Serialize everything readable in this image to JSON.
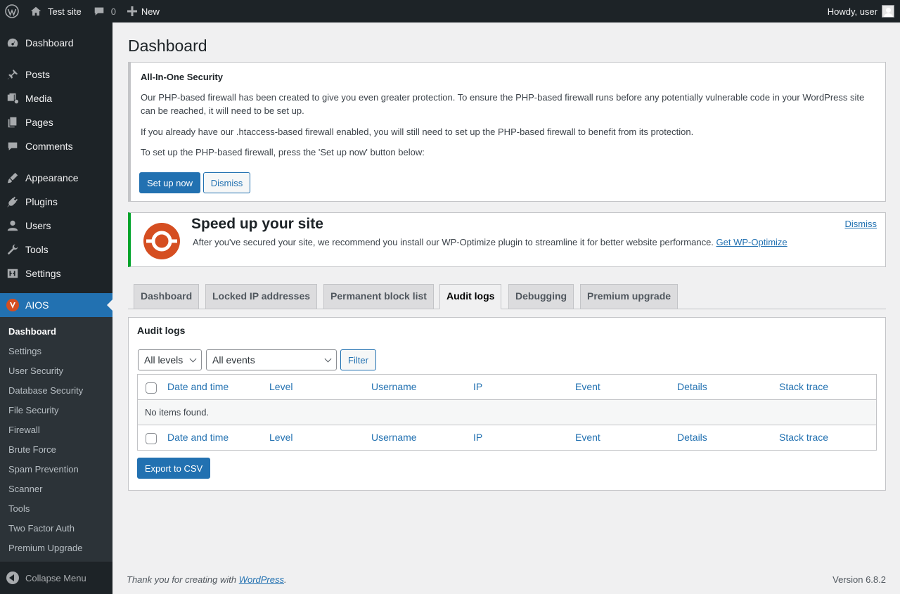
{
  "adminbar": {
    "site_name": "Test site",
    "comments_count": "0",
    "new_label": "New",
    "howdy": "Howdy, user"
  },
  "sidebar": {
    "items": [
      {
        "label": "Dashboard",
        "icon": "dashboard-icon"
      },
      {
        "label": "Posts",
        "icon": "pin-icon"
      },
      {
        "label": "Media",
        "icon": "media-icon"
      },
      {
        "label": "Pages",
        "icon": "pages-icon"
      },
      {
        "label": "Comments",
        "icon": "comment-icon"
      },
      {
        "label": "Appearance",
        "icon": "brush-icon"
      },
      {
        "label": "Plugins",
        "icon": "plug-icon"
      },
      {
        "label": "Users",
        "icon": "user-icon"
      },
      {
        "label": "Tools",
        "icon": "wrench-icon"
      },
      {
        "label": "Settings",
        "icon": "settings-icon"
      },
      {
        "label": "AIOS",
        "icon": "aios-icon"
      }
    ],
    "submenu": [
      "Dashboard",
      "Settings",
      "User Security",
      "Database Security",
      "File Security",
      "Firewall",
      "Brute Force",
      "Spam Prevention",
      "Scanner",
      "Tools",
      "Two Factor Auth",
      "Premium Upgrade"
    ],
    "collapse_label": "Collapse Menu"
  },
  "page": {
    "title": "Dashboard"
  },
  "notice_security": {
    "title": "All-In-One Security",
    "p1": "Our PHP-based firewall has been created to give you even greater protection. To ensure the PHP-based firewall runs before any potentially vulnerable code in your WordPress site can be reached, it will need to be set up.",
    "p2": "If you already have our .htaccess-based firewall enabled, you will still need to set up the PHP-based firewall to benefit from its protection.",
    "p3": "To set up the PHP-based firewall, press the 'Set up now' button below:",
    "setup_button": "Set up now",
    "dismiss_button": "Dismiss"
  },
  "notice_speed": {
    "title": "Speed up your site",
    "text": "After you've secured your site, we recommend you install our WP-Optimize plugin to streamline it for better website performance.",
    "link": "Get WP-Optimize",
    "dismiss": "Dismiss"
  },
  "tabs": [
    "Dashboard",
    "Locked IP addresses",
    "Permanent block list",
    "Audit logs",
    "Debugging",
    "Premium upgrade"
  ],
  "audit": {
    "title": "Audit logs",
    "level_select": "All levels",
    "event_select": "All events",
    "filter_button": "Filter",
    "columns": [
      "Date and time",
      "Level",
      "Username",
      "IP",
      "Event",
      "Details",
      "Stack trace"
    ],
    "empty_message": "No items found.",
    "export_button": "Export to CSV"
  },
  "footer": {
    "thanks_prefix": "Thank you for creating with ",
    "thanks_link": "WordPress",
    "thanks_suffix": ".",
    "version": "Version 6.8.2"
  },
  "colors": {
    "admin_dark": "#1d2327",
    "accent": "#2271b1",
    "success_border": "#00a32a",
    "wpo_orange": "#d54e21"
  }
}
